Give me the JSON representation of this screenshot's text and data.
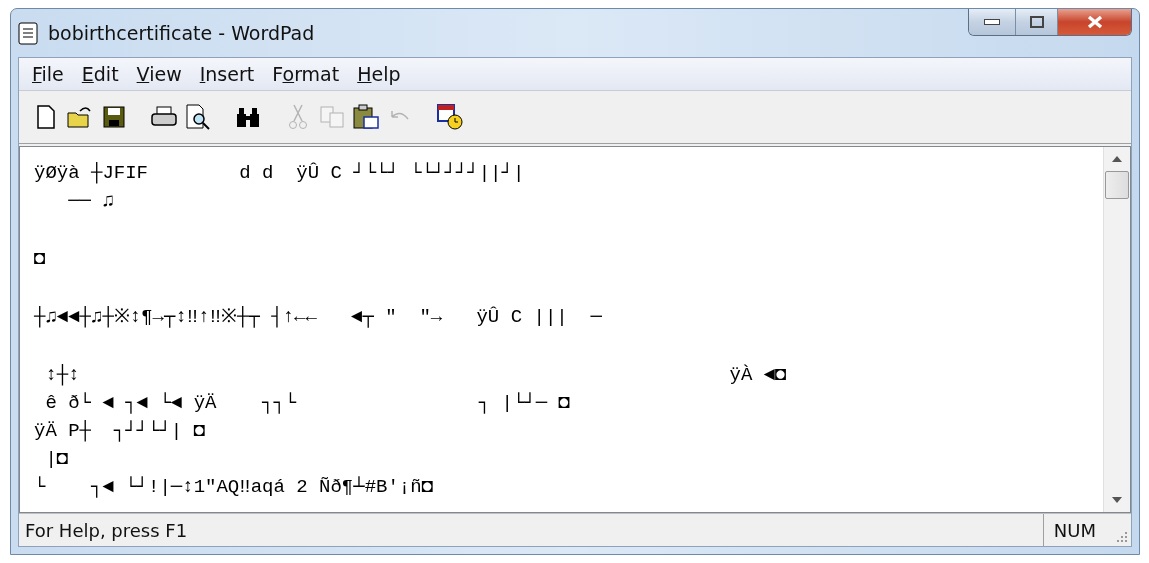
{
  "window": {
    "title": "bobirthcertificate - WordPad"
  },
  "menu": [
    {
      "accel": "F",
      "after": "ile"
    },
    {
      "accel": "E",
      "after": "dit"
    },
    {
      "accel": "V",
      "after": "iew"
    },
    {
      "accel": "I",
      "after": "nsert"
    },
    {
      "before": "F",
      "accel": "o",
      "after": "rmat"
    },
    {
      "accel": "H",
      "after": "elp"
    }
  ],
  "toolbar": [
    [
      {
        "kind": "new",
        "disabled": false
      },
      {
        "kind": "open",
        "disabled": false
      },
      {
        "kind": "save",
        "disabled": false
      }
    ],
    [
      {
        "kind": "print",
        "disabled": false
      },
      {
        "kind": "preview",
        "disabled": false
      }
    ],
    [
      {
        "kind": "find",
        "disabled": false
      }
    ],
    [
      {
        "kind": "cut",
        "disabled": true
      },
      {
        "kind": "copy",
        "disabled": true
      },
      {
        "kind": "paste",
        "disabled": false
      },
      {
        "kind": "undo",
        "disabled": true
      }
    ],
    [
      {
        "kind": "datetime",
        "disabled": false
      }
    ]
  ],
  "document": {
    "blocks": [
      [
        "ÿØÿà ┼JFIF        d d  ÿÛ C ┘└└┘ └└┘┘┘┘||┘|",
        "   ── ♫"
      ],
      [
        "◘"
      ],
      [
        "┼♫◄◄┼♫┼※↕¶→┬↕‼↑‼※┼┬ ┤↑←←   ◄┬ \"  \"→   ÿÛ C |||  ─"
      ],
      [
        " ↕┼↕                                                         ÿÀ ◄◘",
        " ê ð└ ◄ ┐◄ └◄ ÿÄ    ┐┐└                ┐ |└┘─ ◘",
        "ÿÄ P┼  ┐┘┘└┘| ◘",
        " |◘",
        "└    ┐◄ └┘!|─↕1\"AQ‼aqá 2 Ñð¶┴#B'¡ñ◘"
      ]
    ]
  },
  "status_bar": {
    "help": "For Help, press F1",
    "indicator": "NUM"
  }
}
